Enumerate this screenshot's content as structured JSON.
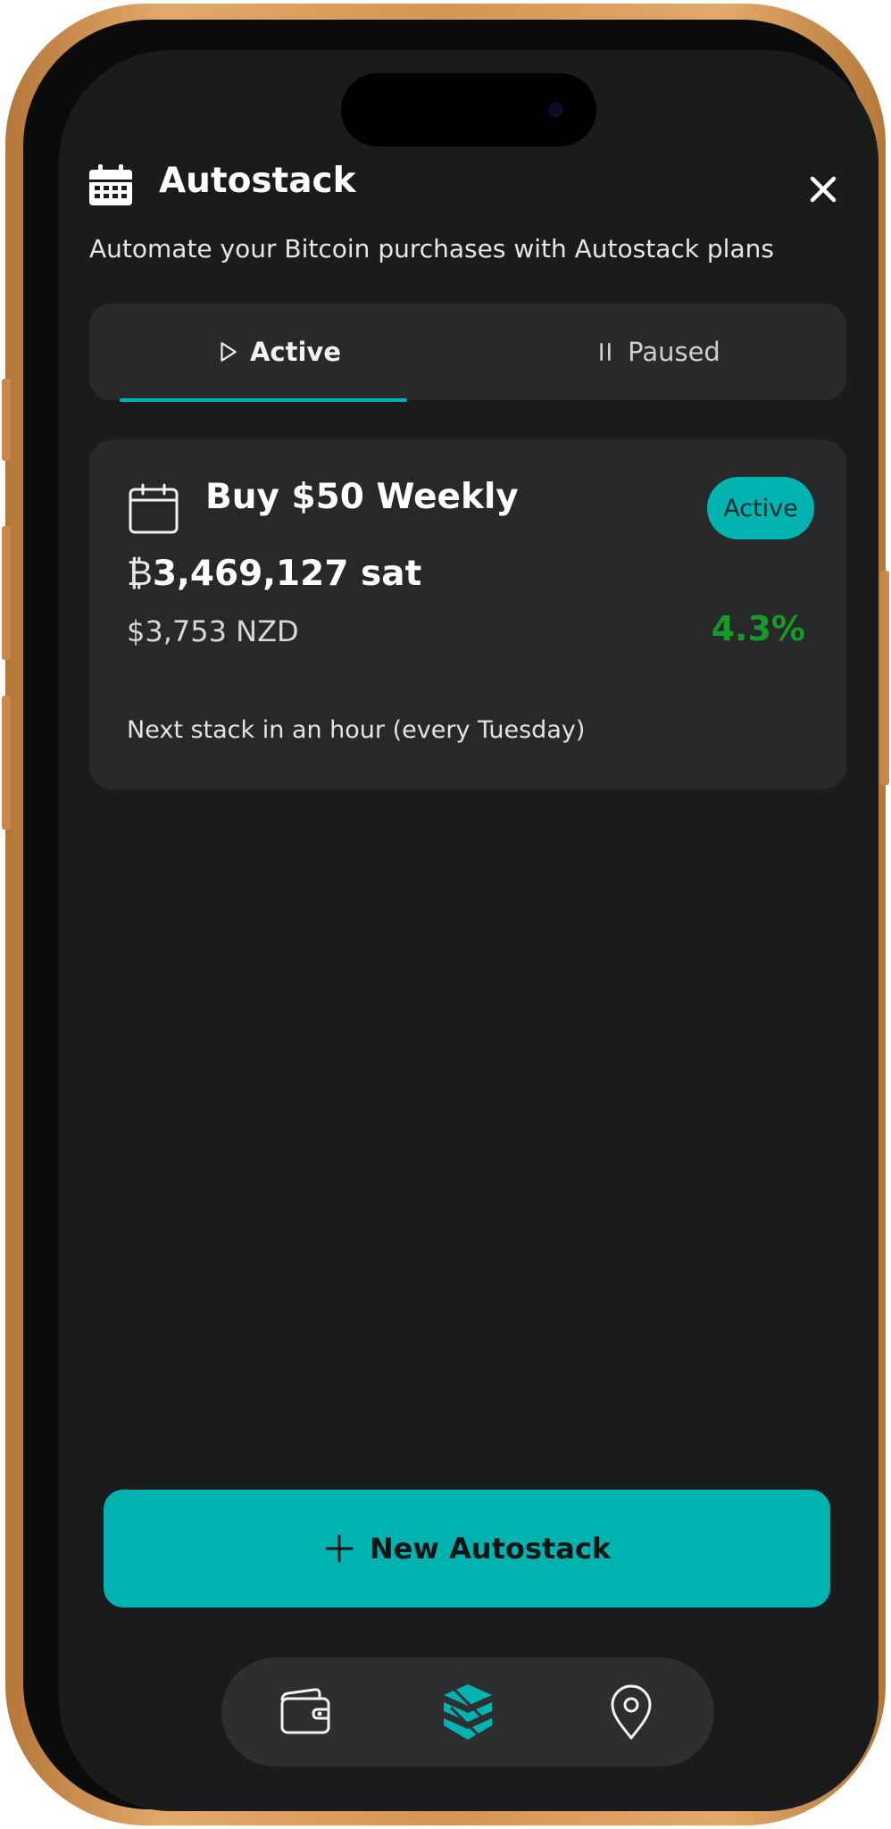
{
  "header": {
    "title": "Autostack",
    "subtitle": "Automate your Bitcoin purchases with Autostack plans",
    "icon": "calendar-icon",
    "close_icon": "close-icon"
  },
  "tabs": [
    {
      "label": "Active",
      "icon": "play-icon",
      "selected": true
    },
    {
      "label": "Paused",
      "icon": "pause-icon",
      "selected": false
    }
  ],
  "plan_card": {
    "icon": "calendar-icon",
    "title": "Buy $50 Weekly",
    "status": "Active",
    "sats_symbol": "₿",
    "sats_amount": "3,469,127 sat",
    "fiat_value": "$3,753 NZD",
    "change": "4.3%",
    "next_stack": "Next stack in an hour (every Tuesday)"
  },
  "new_button": {
    "label": "New Autostack",
    "icon": "plus-icon"
  },
  "bottom_nav": [
    {
      "name": "wallet",
      "icon": "wallet-icon"
    },
    {
      "name": "stack",
      "icon": "stack-logo-icon",
      "selected": true
    },
    {
      "name": "map",
      "icon": "location-pin-icon"
    }
  ],
  "colors": {
    "accent": "#00b3b1",
    "background": "#1a1b1d",
    "card": "#262829",
    "positive": "#159a28"
  }
}
